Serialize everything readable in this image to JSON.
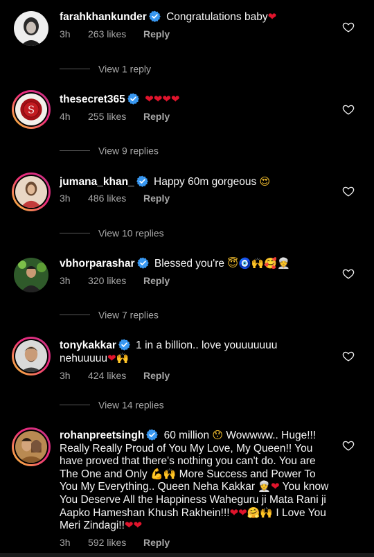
{
  "colors": {
    "background": "#000000",
    "text": "#f5f5f5",
    "secondary": "#a8a8a8",
    "verified": "#3897f0",
    "heart": "#e0142c"
  },
  "comments": [
    {
      "username": "farahkhankunder",
      "text": "Congratulations baby",
      "emojis": [
        "red-heart"
      ],
      "time": "3h",
      "likes": "263 likes",
      "reply": "Reply",
      "view_replies": "View 1 reply"
    },
    {
      "username": "thesecret365",
      "text": "",
      "emojis": [
        "red-heart",
        "red-heart",
        "red-heart",
        "red-heart"
      ],
      "time": "4h",
      "likes": "255 likes",
      "reply": "Reply",
      "view_replies": "View 9 replies"
    },
    {
      "username": "jumana_khan_",
      "text": "Happy 60m gorgeous",
      "emojis": [
        "heart-eyes-face"
      ],
      "time": "3h",
      "likes": "486 likes",
      "reply": "Reply",
      "view_replies": "View 10 replies"
    },
    {
      "username": "vbhorparashar",
      "text": "Blessed you're",
      "emojis": [
        "halo-face",
        "evil-eye",
        "raised-hands",
        "hearts-face",
        "person-with-turban"
      ],
      "time": "3h",
      "likes": "320 likes",
      "reply": "Reply",
      "view_replies": "View 7 replies"
    },
    {
      "username": "tonykakkar",
      "text_part1": "1 in a billion.. love youuuuuuu",
      "text_part2": "nehuuuuu",
      "emojis": [
        "red-heart",
        "raised-hands"
      ],
      "time": "3h",
      "likes": "424 likes",
      "reply": "Reply",
      "view_replies": "View 14 replies"
    },
    {
      "username": "rohanpreetsingh",
      "text_a": "60 million",
      "text_b": "Wowwww.. Huge!!! Really Really Proud of You My Love, My Queen!! You have proved that there's nothing you can't do. You are The One and Only",
      "text_c": "More Success and Power To You My Everything.. Queen Neha Kakkar",
      "text_d": "You know You Deserve All the Happiness Waheguru ji Mata Rani ji Aapko Hameshan Khush Rakhein!!!",
      "text_e": "I Love You Meri Zindagi!!",
      "emojis": [
        "hushed-face",
        "flexed-arm",
        "raised-hands",
        "person-with-turban",
        "red-heart",
        "hugging-face"
      ],
      "time": "3h",
      "likes": "592 likes",
      "reply": "Reply"
    }
  ]
}
